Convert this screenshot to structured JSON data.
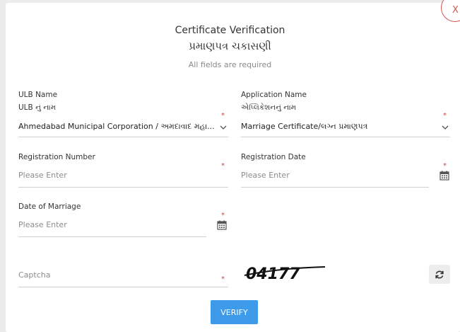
{
  "dialog": {
    "close_label": "X",
    "title_en": "Certificate Verification",
    "title_gu": "પ્રમાણપત્ર ચકાસણી",
    "subtitle": "All fields are required"
  },
  "form": {
    "required_mark": "*",
    "ulb": {
      "label_en": "ULB Name",
      "label_gu": "ULB નું નામ",
      "value": "Ahmedabad Municipal Corporation / અમદાવાદ મહા..."
    },
    "application": {
      "label_en": "Application Name",
      "label_gu": "એપ્લિકેશનનું નામ",
      "value": "Marriage Certificate/લગ્ન પ્રમાણપત્ર"
    },
    "registration_number": {
      "label": "Registration Number",
      "placeholder": "Please Enter"
    },
    "registration_date": {
      "label": "Registration Date",
      "placeholder": "Please Enter"
    },
    "date_of_marriage": {
      "label": "Date of Marriage",
      "placeholder": "Please Enter"
    },
    "captcha": {
      "placeholder": "Captcha",
      "image_text": "04177"
    },
    "verify_label": "VERIFY"
  },
  "icons": {
    "close": "close-icon",
    "chevron": "chevron-down-icon",
    "calendar": "calendar-icon",
    "refresh": "refresh-icon"
  },
  "colors": {
    "accent": "#3d9be9",
    "required": "#e53935",
    "close": "#d9534f"
  }
}
